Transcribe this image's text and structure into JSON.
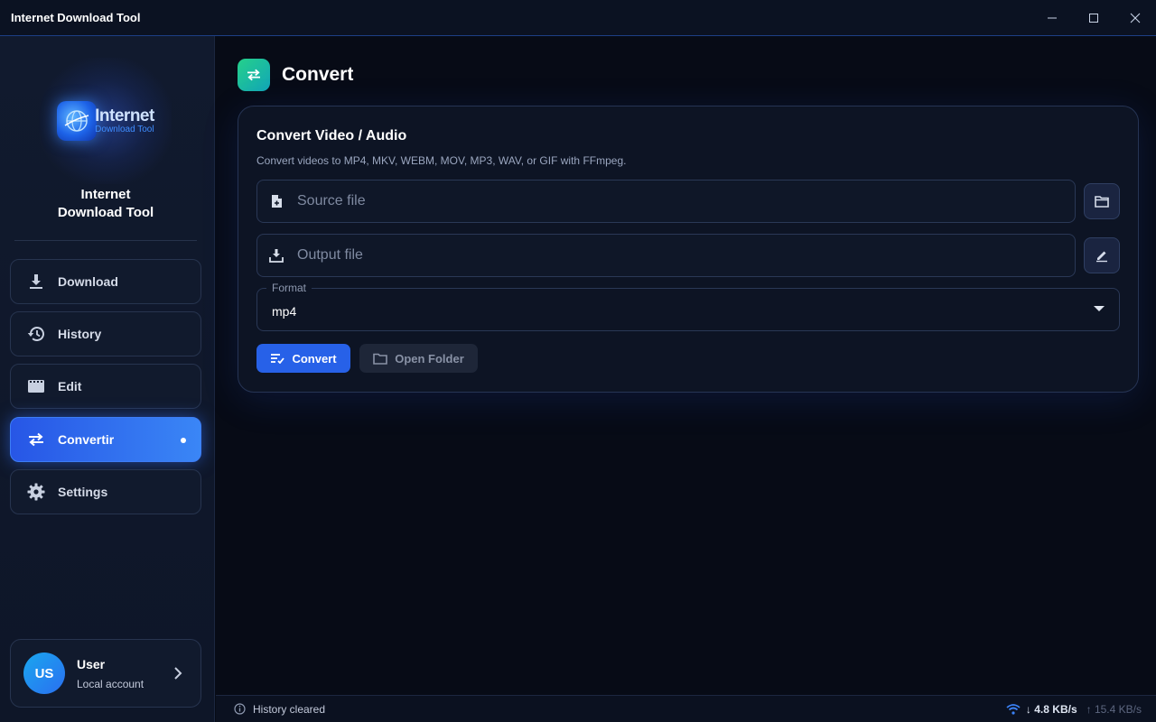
{
  "window": {
    "title": "Internet Download Tool"
  },
  "sidebar": {
    "logo": {
      "line1": "Internet",
      "line2": "Download Tool"
    },
    "brand": {
      "line1": "Internet",
      "line2": "Download Tool"
    },
    "items": [
      {
        "label": "Download",
        "icon": "download-icon",
        "active": false
      },
      {
        "label": "History",
        "icon": "history-icon",
        "active": false
      },
      {
        "label": "Edit",
        "icon": "film-icon",
        "active": false
      },
      {
        "label": "Convertir",
        "icon": "swap-icon",
        "active": true
      },
      {
        "label": "Settings",
        "icon": "gear-icon",
        "active": false
      }
    ],
    "user": {
      "initials": "US",
      "name": "User",
      "subtitle": "Local account"
    }
  },
  "main": {
    "title": "Convert",
    "card": {
      "title": "Convert Video / Audio",
      "subtitle": "Convert videos to MP4, MKV, WEBM, MOV, MP3, WAV, or GIF with FFmpeg.",
      "source": {
        "placeholder": "Source file",
        "value": ""
      },
      "output": {
        "placeholder": "Output file",
        "value": ""
      },
      "format": {
        "label": "Format",
        "value": "mp4"
      },
      "convert_label": "Convert",
      "open_folder_label": "Open Folder"
    }
  },
  "statusbar": {
    "message": "History cleared",
    "download_speed": "↓ 4.8 KB/s",
    "upload_speed": "↑ 15.4 KB/s"
  },
  "colors": {
    "accent": "#2761e8",
    "background": "#070b16",
    "sidebar": "#111a2e",
    "convert_icon": "#25d08a"
  }
}
